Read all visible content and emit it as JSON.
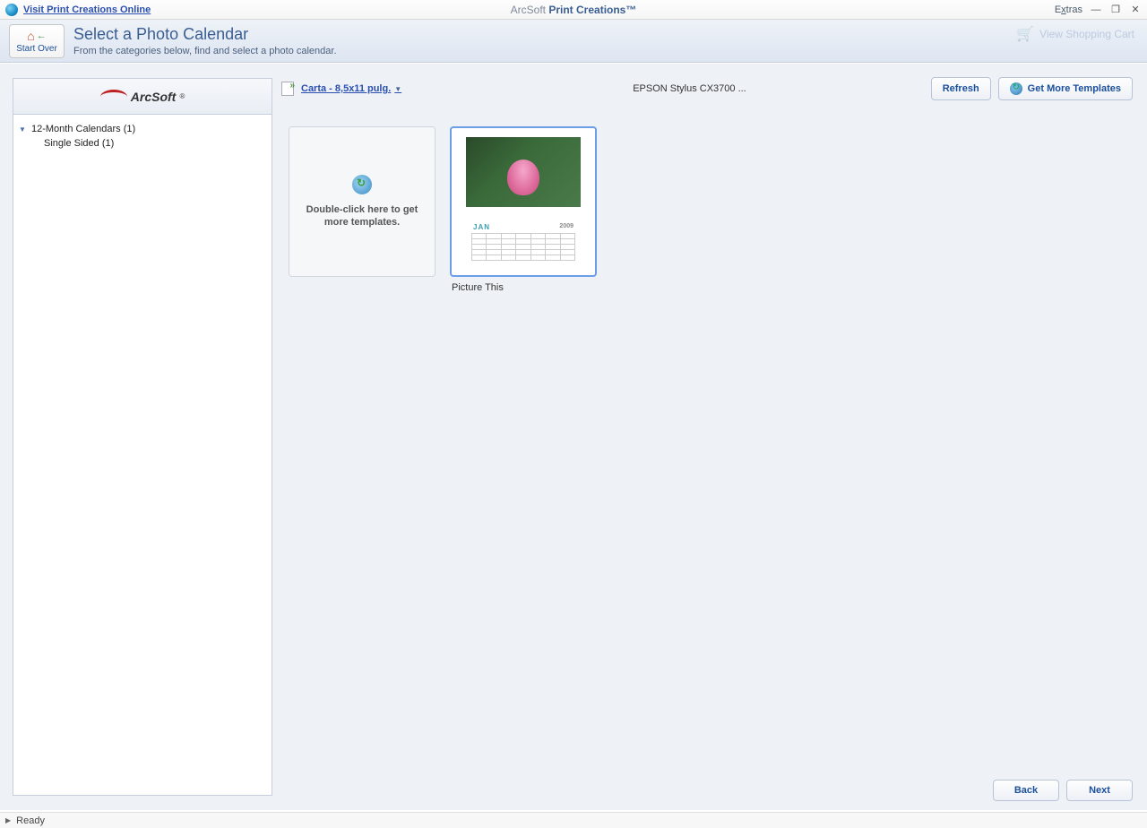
{
  "titlebar": {
    "visit_link": "Visit Print Creations Online",
    "brand_prefix": "ArcSoft",
    "product_name": "Print Creations™",
    "extras_prefix": "E",
    "extras_underlined": "x",
    "extras_suffix": "tras"
  },
  "header": {
    "start_over_label": "Start Over",
    "page_title": "Select a Photo Calendar",
    "page_subtitle": "From the categories below, find and select a photo calendar.",
    "cart_label": "View Shopping Cart"
  },
  "sidebar": {
    "logo_text": "ArcSoft",
    "categories": [
      {
        "label": "12-Month Calendars (1)",
        "children": [
          {
            "label": "Single Sided (1)"
          }
        ]
      }
    ]
  },
  "toolbar": {
    "paper_label": "Carta - 8,5x11 pulg.",
    "printer_label": "EPSON Stylus CX3700 ...",
    "refresh_label": "Refresh",
    "get_more_label": "Get More Templates"
  },
  "gallery": {
    "get_more_tile_text": "Double-click here to get more templates.",
    "template_month": "JAN",
    "template_year": "2009",
    "template1_label": "Picture This"
  },
  "bottom": {
    "back_label": "Back",
    "next_label": "Next"
  },
  "status": {
    "text": "Ready"
  }
}
